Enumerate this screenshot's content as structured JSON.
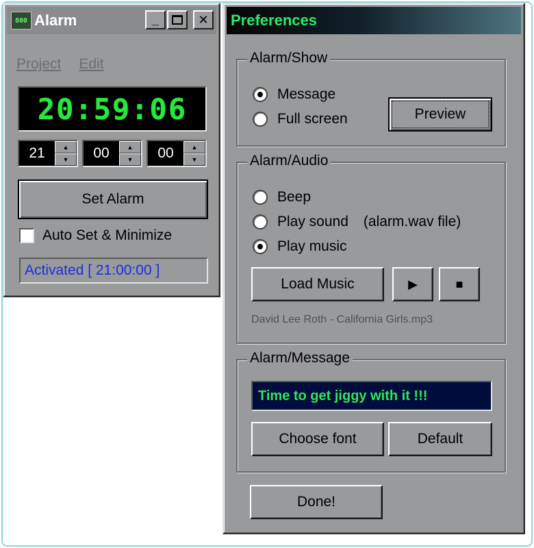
{
  "alarm_window": {
    "title": "Alarm",
    "app_icon_text": "800",
    "menu": [
      "Project",
      "Edit"
    ],
    "clock": "20:59:06",
    "spinners": [
      {
        "value": "21"
      },
      {
        "value": "00"
      },
      {
        "value": "00"
      }
    ],
    "set_alarm_label": "Set Alarm",
    "auto_set_label": "Auto Set & Minimize",
    "auto_set_checked": false,
    "status": "Activated  [ 21:00:00 ]"
  },
  "preferences_window": {
    "title": "Preferences",
    "show_group": {
      "legend": "Alarm/Show",
      "options": [
        "Message",
        "Full screen"
      ],
      "selected": "Message",
      "preview_label": "Preview"
    },
    "audio_group": {
      "legend": "Alarm/Audio",
      "options": [
        "Beep",
        "Play sound",
        "Play music"
      ],
      "play_sound_hint": "(alarm.wav file)",
      "selected": "Play music",
      "load_music_label": "Load Music",
      "play_icon": "play-icon",
      "stop_icon": "stop-icon",
      "song": "David Lee Roth - California Girls.mp3"
    },
    "message_group": {
      "legend": "Alarm/Message",
      "message": "Time to get jiggy with it !!!",
      "choose_font_label": "Choose font",
      "default_label": "Default"
    },
    "done_label": "Done!"
  },
  "colors": {
    "window_bg": "#999a9c",
    "clock_green": "#27e83c",
    "status_blue": "#1a2fe0",
    "message_bg": "#000c3c",
    "message_green": "#2ee85a",
    "prefs_title_green": "#2ee86a"
  }
}
